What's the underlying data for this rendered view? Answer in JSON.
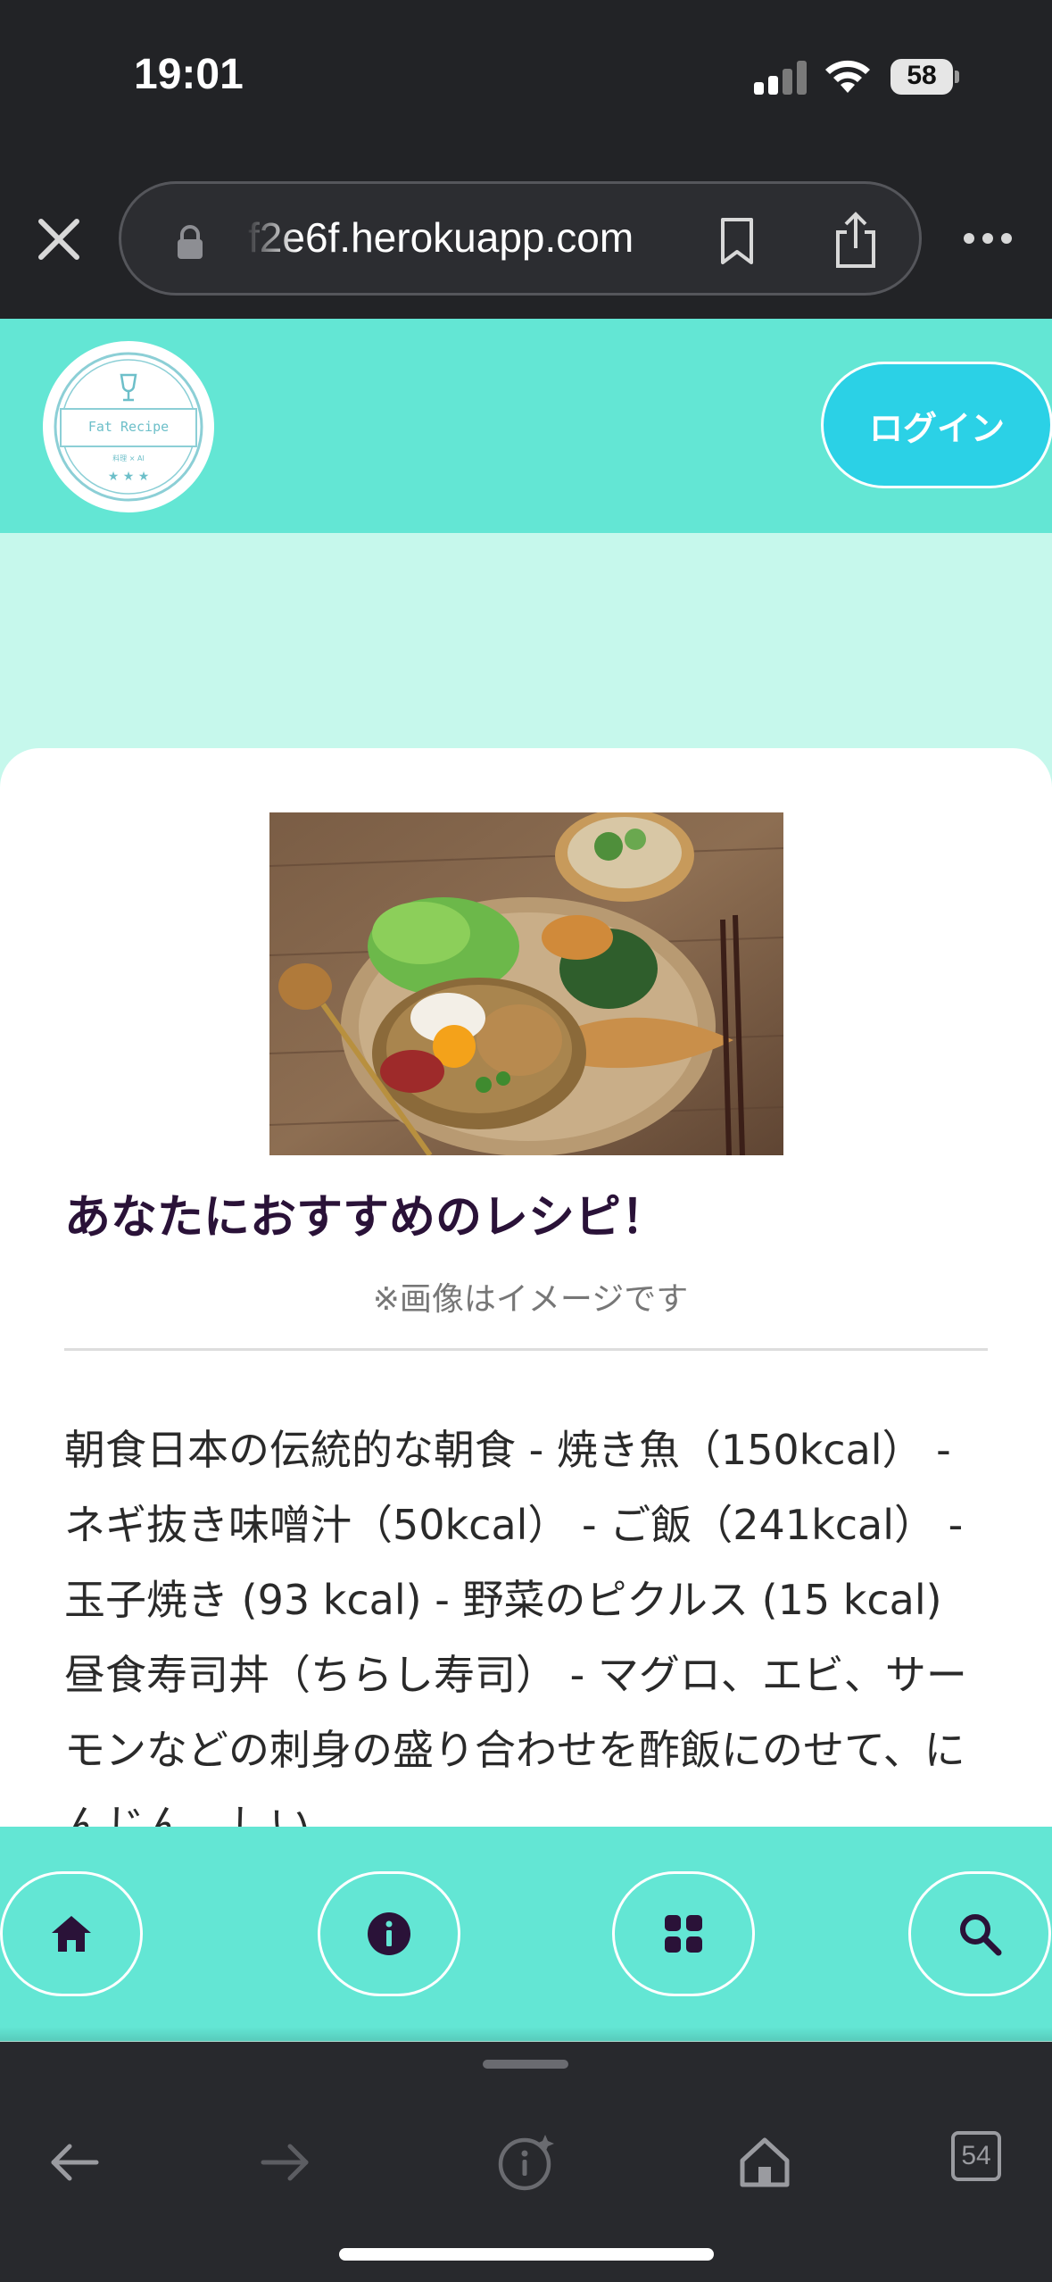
{
  "status_bar": {
    "time": "19:01",
    "battery": "58"
  },
  "browser": {
    "url": "f2e6f.herokuapp.com",
    "tab_count": "54"
  },
  "header": {
    "logo_text": "Fat Recipe",
    "logo_subtext": "料理 × AI",
    "login_label": "ログイン"
  },
  "card": {
    "title": "あなたにおすすめのレシピ！",
    "image_note": "※画像はイメージです",
    "body": "朝食日本の伝統的な朝食 - 焼き魚（150kcal） - ネギ抜き味噌汁（50kcal） - ご飯（241kcal） - 玉子焼き (93 kcal) - 野菜のピクルス (15 kcal) 昼食寿司丼（ちらし寿司） - マグロ、エビ、サーモンなどの刺身の盛り合わせを酢飯にのせて、にんじん、しい"
  },
  "bottom_nav": {
    "items": [
      {
        "icon": "home-icon"
      },
      {
        "icon": "info-icon"
      },
      {
        "icon": "grid-icon"
      },
      {
        "icon": "search-icon"
      }
    ]
  },
  "colors": {
    "header_bg": "#63e6d4",
    "page_bg": "#c6f8ec",
    "login_button": "#2bd1e6",
    "nav_icon": "#2a1238"
  }
}
